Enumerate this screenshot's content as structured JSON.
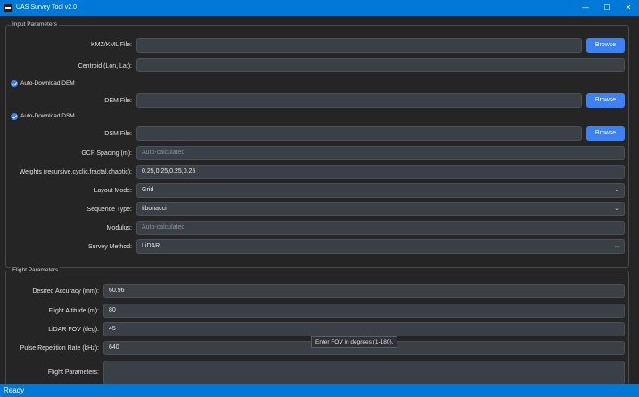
{
  "window": {
    "title": "UAS Survey Tool v2.0",
    "controls": {
      "minimize": "—",
      "maximize": "☐",
      "close": "✕"
    }
  },
  "input_parameters": {
    "title": "Input Parameters",
    "kmz": {
      "label": "KMZ/KML File:",
      "value": "",
      "browse": "Browse"
    },
    "centroid": {
      "label": "Centroid (Lon, Lat):",
      "value": ""
    },
    "auto_dem": {
      "label": "Auto-Download DEM",
      "checked": true
    },
    "dem": {
      "label": "DEM File:",
      "value": "",
      "browse": "Browse"
    },
    "auto_dsm": {
      "label": "Auto-Download DSM",
      "checked": true
    },
    "dsm": {
      "label": "DSM File:",
      "value": "",
      "browse": "Browse"
    },
    "gcp_spacing": {
      "label": "GCP Spacing (m):",
      "placeholder": "Auto-calculated"
    },
    "weights": {
      "label": "Weights (recursive,cyclic,fractal,chaotic):",
      "value": "0.25,0.25,0.25,0.25"
    },
    "layout_mode": {
      "label": "Layout Mode:",
      "value": "Grid"
    },
    "sequence_type": {
      "label": "Sequence Type:",
      "value": "fibonacci"
    },
    "modulus": {
      "label": "Modulus:",
      "placeholder": "Auto-calculated"
    },
    "survey_method": {
      "label": "Survey Method:",
      "value": "LiDAR"
    }
  },
  "flight_parameters": {
    "title": "Flight Parameters",
    "accuracy": {
      "label": "Desired Accuracy (mm):",
      "value": "60.96"
    },
    "altitude": {
      "label": "Flight Altitude (m):",
      "value": "80"
    },
    "lidar_fov": {
      "label": "LiDAR FOV (deg):",
      "value": "45"
    },
    "prr": {
      "label": "Pulse Repetition Rate (kHz):",
      "value": "640"
    },
    "flight_params": {
      "label": "Flight Parameters:",
      "value": ""
    }
  },
  "tooltip": "Enter FOV in degrees (1-180).",
  "status": "Ready",
  "icons": {
    "dropdown": "chevron-down-icon",
    "check": "check-icon"
  }
}
